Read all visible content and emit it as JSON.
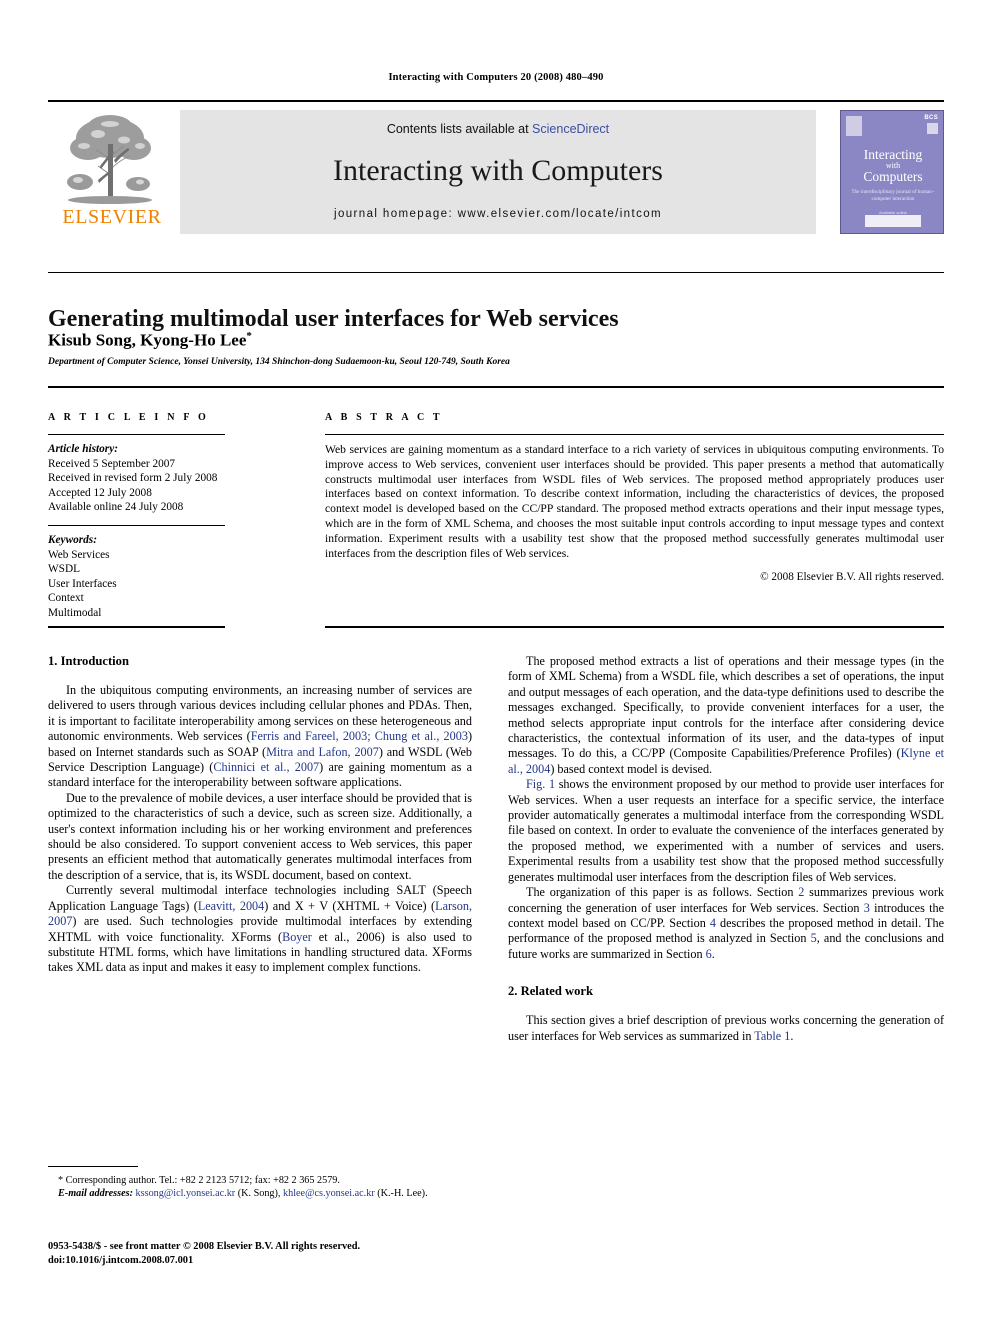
{
  "running_head": "Interacting with Computers 20 (2008) 480–490",
  "masthead": {
    "contents_prefix": "Contents lists available at ",
    "sciencedirect": "ScienceDirect",
    "journal_title": "Interacting with Computers",
    "homepage": "journal homepage: www.elsevier.com/locate/intcom",
    "publisher_wordmark": "ELSEVIER",
    "publisher_logo_icon": "elsevier-tree-icon",
    "accent_orange": "#ef8200",
    "link_blue": "#3a4fa0",
    "band_gray": "#e4e4e4",
    "cover": {
      "bcs_label": "BCS",
      "line1": "Interacting",
      "line2": "with",
      "line3": "Computers",
      "subtitle": "The interdisciplinary journal of human–computer interaction",
      "footer": "Available online",
      "footer2": "ScienceDirect",
      "background": "#8b87c4"
    }
  },
  "article": {
    "title": "Generating multimodal user interfaces for Web services",
    "authors": "Kisub Song, Kyong-Ho Lee",
    "corresponding_marker": "*",
    "affiliation": "Department of Computer Science, Yonsei University, 134 Shinchon-dong Sudaemoon-ku, Seoul 120-749, South Korea"
  },
  "info": {
    "heading": "A R T I C L E   I N F O",
    "history_label": "Article history:",
    "history": [
      "Received 5 September 2007",
      "Received in revised form 2 July 2008",
      "Accepted 12 July 2008",
      "Available online 24 July 2008"
    ],
    "keywords_label": "Keywords:",
    "keywords": [
      "Web Services",
      "WSDL",
      "User Interfaces",
      "Context",
      "Multimodal"
    ]
  },
  "abstract": {
    "heading": "A B S T R A C T",
    "text": "Web services are gaining momentum as a standard interface to a rich variety of services in ubiquitous computing environments. To improve access to Web services, convenient user interfaces should be provided. This paper presents a method that automatically constructs multimodal user interfaces from WSDL files of Web services. The proposed method appropriately produces user interfaces based on context information. To describe context information, including the characteristics of devices, the proposed context model is developed based on the CC/PP standard. The proposed method extracts operations and their input message types, which are in the form of XML Schema, and chooses the most suitable input controls according to input message types and context information. Experiment results with a usability test show that the proposed method successfully generates multimodal user interfaces from the description files of Web services.",
    "copyright": "© 2008 Elsevier B.V. All rights reserved."
  },
  "body": {
    "intro_heading": "1. Introduction",
    "intro_p1_a": "In the ubiquitous computing environments, an increasing number of services are delivered to users through various devices including cellular phones and PDAs. Then, it is important to facilitate interoperability among services on these heterogeneous and autonomic environments. Web services (",
    "cite_ferris": "Ferris and Fareel, 2003; Chung et al., 2003",
    "intro_p1_b": ") based on Internet standards such as SOAP (",
    "cite_mitra": "Mitra and Lafon, 2007",
    "intro_p1_c": ") and WSDL (Web Service Description Language) (",
    "cite_chinnici": "Chinnici et al., 2007",
    "intro_p1_d": ") are gaining momentum as a standard interface for the interoperability between software applications.",
    "intro_p2": "Due to the prevalence of mobile devices, a user interface should be provided that is optimized to the characteristics of such a device, such as screen size. Additionally, a user's context information including his or her working environment and preferences should be also considered. To support convenient access to Web services, this paper presents an efficient method that automatically generates multimodal interfaces from the description of a service, that is, its WSDL document, based on context.",
    "intro_p3_a": "Currently several multimodal interface technologies including SALT (Speech Application Language Tags) (",
    "cite_leavitt": "Leavitt, 2004",
    "intro_p3_b": ") and X + V (XHTML + Voice) (",
    "cite_larson": "Larson, 2007",
    "intro_p3_c": ") are used. Such technologies provide multimodal interfaces by extending XHTML with voice functionality. XForms (",
    "cite_boyer": "Boyer",
    "intro_p3_d": " et al., 2006) is also used to substitute HTML forms, which have limitations in handling structured data. XForms takes XML data as input and makes it easy to implement complex functions.",
    "right_p1_a": "The proposed method extracts a list of operations and their message types (in the form of XML Schema) from a WSDL file, which describes a set of operations, the input and output messages of each operation, and the data-type definitions used to describe the messages exchanged. Specifically, to provide convenient interfaces for a user, the method selects appropriate input controls for the interface after considering device characteristics, the contextual information of its user, and the data-types of input messages. To do this, a CC/PP (Composite Capabilities/Preference Profiles) (",
    "cite_klyne": "Klyne et al., 2004",
    "right_p1_b": ") based context model is devised.",
    "cite_fig1": "Fig. 1",
    "right_p2": " shows the environment proposed by our method to provide user interfaces for Web services. When a user requests an interface for a specific service, the interface provider automatically generates a multimodal interface from the corresponding WSDL file based on context. In order to evaluate the convenience of the interfaces generated by the proposed method, we experimented with a number of services and users. Experimental results from a usability test show that the proposed method successfully generates multimodal user interfaces from the description files of Web services.",
    "right_p3_a": "The organization of this paper is as follows. Section ",
    "sec2": "2",
    "right_p3_b": " summarizes previous work concerning the generation of user interfaces for Web services. Section ",
    "sec3": "3",
    "right_p3_c": " introduces the context model based on CC/PP. Section ",
    "sec4": "4",
    "right_p3_d": " describes the proposed method in detail. The performance of the proposed method is analyzed in Section ",
    "sec5": "5",
    "right_p3_e": ", and the conclusions and future works are summarized in Section ",
    "sec6": "6",
    "right_p3_f": ".",
    "related_heading": "2. Related work",
    "related_p1_a": "This section gives a brief description of previous works concerning the generation of user interfaces for Web services as summarized in ",
    "cite_table1": "Table 1",
    "related_p1_b": "."
  },
  "footnotes": {
    "corresponding": "* Corresponding author. Tel.: +82 2 2123 5712; fax: +82 2 365 2579.",
    "email_label": "E-mail addresses:",
    "email1": "kssong@icl.yonsei.ac.kr",
    "email1_owner": " (K. Song), ",
    "email2": "khlee@cs.yonsei.ac.kr",
    "email2_owner": " (K.-H. Lee)."
  },
  "imprint": {
    "line1": "0953-5438/$ - see front matter © 2008 Elsevier B.V. All rights reserved.",
    "line2": "doi:10.1016/j.intcom.2008.07.001"
  }
}
